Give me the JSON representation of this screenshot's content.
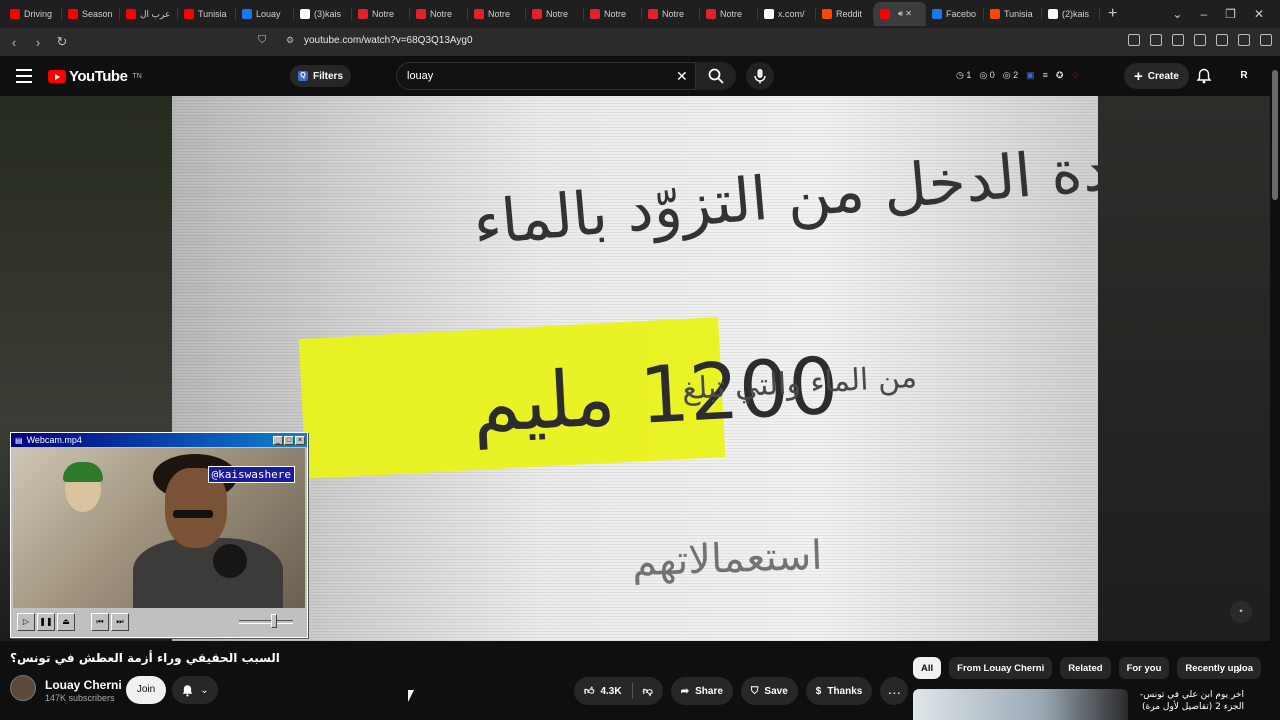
{
  "browser": {
    "tabs": [
      {
        "label": "Driving",
        "color": "#ff0000"
      },
      {
        "label": "Season",
        "color": "#ff0000"
      },
      {
        "label": "عرب ال",
        "color": "#ff0000"
      },
      {
        "label": "Tunisia",
        "color": "#ff0000"
      },
      {
        "label": "Louay",
        "color": "#1877f2"
      },
      {
        "label": "(3)kais",
        "color": "#ffffff"
      },
      {
        "label": "Notre",
        "color": "#e5202d"
      },
      {
        "label": "Notre",
        "color": "#e5202d"
      },
      {
        "label": "Notre",
        "color": "#e5202d"
      },
      {
        "label": "Notre",
        "color": "#e5202d"
      },
      {
        "label": "Notre",
        "color": "#e5202d"
      },
      {
        "label": "Notre",
        "color": "#e5202d"
      },
      {
        "label": "Notre",
        "color": "#e5202d"
      },
      {
        "label": "x.com/",
        "color": "#ffffff"
      },
      {
        "label": "Reddit",
        "color": "#ff4500"
      },
      {
        "label": "",
        "color": "#ff0000"
      },
      {
        "label": "Facebo",
        "color": "#1877f2"
      },
      {
        "label": "Tunisia",
        "color": "#ff4500"
      },
      {
        "label": "(2)kais",
        "color": "#ffffff"
      }
    ],
    "url": "youtube.com/watch?v=68Q3Q13Ayg0"
  },
  "youtube": {
    "logo_text": "YouTube",
    "logo_tm": "TN",
    "filters_label": "Filters",
    "search_value": "louay",
    "ext_counts": [
      "1",
      "0",
      "2"
    ],
    "create_label": "Create",
    "avatar_letter": "R"
  },
  "video": {
    "overlay_line1": "محدودة الدخل من التزوّد بالماء",
    "overlay_line2": "من الماء والتي تبلغ",
    "overlay_big": "1200 مليم",
    "overlay_line4": "استعمالاتهم"
  },
  "webcam": {
    "window_title": "Webcam.mp4",
    "handle": "@kaiswashere"
  },
  "meta": {
    "title": "السبب الحقيقي وراء أزمة العطش في تونس؟",
    "channel_name": "Louay Cherni",
    "subscribers": "147K subscribers",
    "join_label": "Join",
    "like_count": "4.3K",
    "share_label": "Share",
    "save_label": "Save",
    "thanks_label": "Thanks"
  },
  "chips": [
    "All",
    "From Louay Cherni",
    "Related",
    "For you",
    "Recently uploa"
  ],
  "recommendation": {
    "title": "اخر يوم ابن علي في تونس- الجزء 2 (تفاصيل لأول مرة)"
  },
  "colors": {
    "accent": "#ff0000",
    "highlight": "#e9f21a",
    "background": "#0f0f0f"
  }
}
